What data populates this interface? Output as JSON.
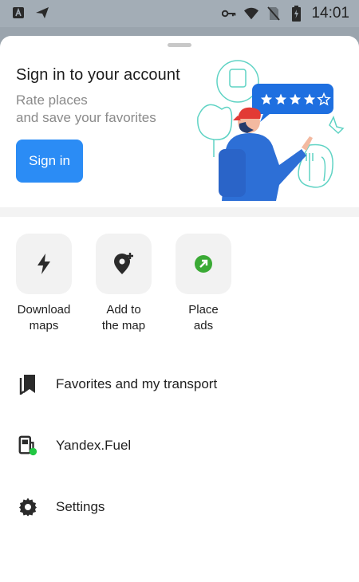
{
  "status_bar": {
    "time": "14:01",
    "icons": [
      "a-letter-icon",
      "send-icon",
      "key-icon",
      "wifi-icon",
      "no-sim-icon",
      "battery-charging-icon"
    ]
  },
  "promo": {
    "title": "Sign in to your account",
    "subtitle_line1": "Rate places",
    "subtitle_line2": "and save your favorites",
    "button_label": "Sign in",
    "rating_stars": 4,
    "rating_max": 5
  },
  "quick_actions": [
    {
      "line1": "Download",
      "line2": "maps",
      "icon": "lightning-icon"
    },
    {
      "line1": "Add to",
      "line2": "the map",
      "icon": "add-place-icon"
    },
    {
      "line1": "Place",
      "line2": "ads",
      "icon": "arrow-up-right-icon"
    }
  ],
  "menu": [
    {
      "label": "Favorites and my transport",
      "icon": "bookmarks-icon"
    },
    {
      "label": "Yandex.Fuel",
      "icon": "fuel-pump-icon"
    },
    {
      "label": "Settings",
      "icon": "gear-icon"
    }
  ],
  "colors": {
    "accent": "#2b8cf5",
    "ads_green": "#3aaa35",
    "fuel_dot": "#22c743",
    "tile_bg": "#f2f2f2"
  }
}
